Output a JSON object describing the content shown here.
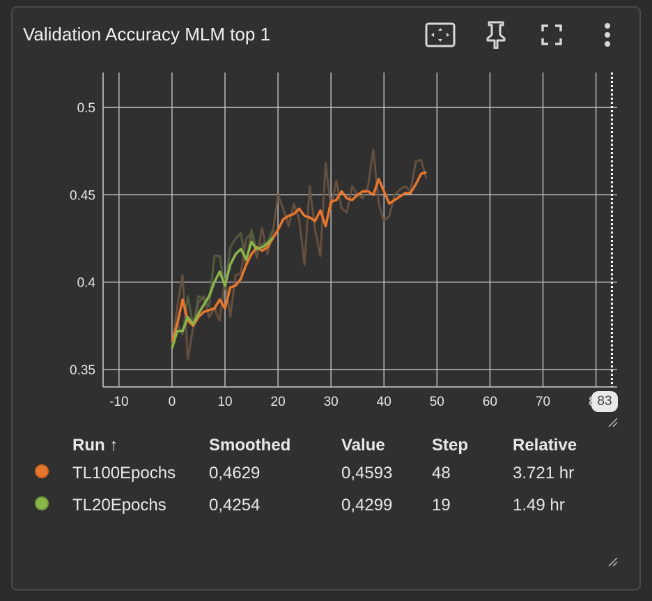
{
  "header": {
    "title": "Validation Accuracy MLM top 1"
  },
  "toolbar": {
    "fit_icon": "fit-domain-icon",
    "pin_icon": "pin-icon",
    "fullscreen_icon": "fullscreen-icon",
    "more_icon": "more-vert-icon"
  },
  "step_marker": {
    "label": "83"
  },
  "table": {
    "headers": {
      "run": "Run ↑",
      "smoothed": "Smoothed",
      "value": "Value",
      "step": "Step",
      "relative": "Relative"
    },
    "rows": [
      {
        "run": "TL100Epochs",
        "smoothed": "0,4629",
        "value": "0,4593",
        "step": "48",
        "relative": "3.721 hr",
        "color": "#e8772e"
      },
      {
        "run": "TL20Epochs",
        "smoothed": "0,4254",
        "value": "0,4299",
        "step": "19",
        "relative": "1.49 hr",
        "color": "#8bb54b"
      }
    ]
  },
  "chart_data": {
    "type": "line",
    "xlim": [
      -13,
      84
    ],
    "ylim": [
      0.34,
      0.52
    ],
    "x_ticks": [
      "-10",
      "0",
      "10",
      "20",
      "30",
      "40",
      "50",
      "60",
      "70",
      "80"
    ],
    "y_ticks": [
      "0.35",
      "0.4",
      "0.45",
      "0.5"
    ],
    "grid": true,
    "step_marker_x": 83,
    "series": [
      {
        "name": "TL100Epochs",
        "color": "#e8772e",
        "raw_color": "#6b5340",
        "x": [
          0,
          1,
          2,
          3,
          4,
          5,
          6,
          7,
          8,
          9,
          10,
          11,
          12,
          13,
          14,
          15,
          16,
          17,
          18,
          19,
          20,
          21,
          22,
          23,
          24,
          25,
          26,
          27,
          28,
          29,
          30,
          31,
          32,
          33,
          34,
          35,
          36,
          37,
          38,
          39,
          40,
          41,
          42,
          43,
          44,
          45,
          46,
          47,
          48
        ],
        "smoothed": [
          0.366,
          0.376,
          0.39,
          0.378,
          0.375,
          0.38,
          0.383,
          0.384,
          0.385,
          0.39,
          0.385,
          0.397,
          0.398,
          0.402,
          0.41,
          0.416,
          0.42,
          0.418,
          0.42,
          0.425,
          0.43,
          0.436,
          0.438,
          0.439,
          0.442,
          0.438,
          0.437,
          0.435,
          0.441,
          0.432,
          0.446,
          0.447,
          0.452,
          0.448,
          0.447,
          0.45,
          0.452,
          0.452,
          0.45,
          0.459,
          0.452,
          0.445,
          0.447,
          0.449,
          0.451,
          0.451,
          0.456,
          0.462,
          0.4629
        ],
        "raw": [
          0.362,
          0.386,
          0.404,
          0.356,
          0.374,
          0.388,
          0.392,
          0.38,
          0.385,
          0.378,
          0.402,
          0.38,
          0.404,
          0.405,
          0.425,
          0.428,
          0.414,
          0.431,
          0.416,
          0.428,
          0.45,
          0.442,
          0.432,
          0.445,
          0.436,
          0.41,
          0.455,
          0.43,
          0.415,
          0.468,
          0.442,
          0.458,
          0.442,
          0.44,
          0.455,
          0.45,
          0.448,
          0.455,
          0.476,
          0.445,
          0.435,
          0.438,
          0.45,
          0.453,
          0.455,
          0.452,
          0.469,
          0.47,
          0.4593
        ]
      },
      {
        "name": "TL20Epochs",
        "color": "#8bb54b",
        "raw_color": "#55603f",
        "x": [
          0,
          1,
          2,
          3,
          4,
          5,
          6,
          7,
          8,
          9,
          10,
          11,
          12,
          13,
          14,
          15,
          16,
          17,
          18,
          19
        ],
        "smoothed": [
          0.362,
          0.372,
          0.372,
          0.38,
          0.376,
          0.382,
          0.387,
          0.392,
          0.4,
          0.406,
          0.398,
          0.41,
          0.416,
          0.419,
          0.413,
          0.423,
          0.419,
          0.42,
          0.422,
          0.4254
        ],
        "raw": [
          0.362,
          0.376,
          0.37,
          0.392,
          0.375,
          0.392,
          0.39,
          0.386,
          0.415,
          0.415,
          0.396,
          0.42,
          0.425,
          0.428,
          0.41,
          0.43,
          0.418,
          0.422,
          0.423,
          0.4299
        ]
      }
    ]
  }
}
